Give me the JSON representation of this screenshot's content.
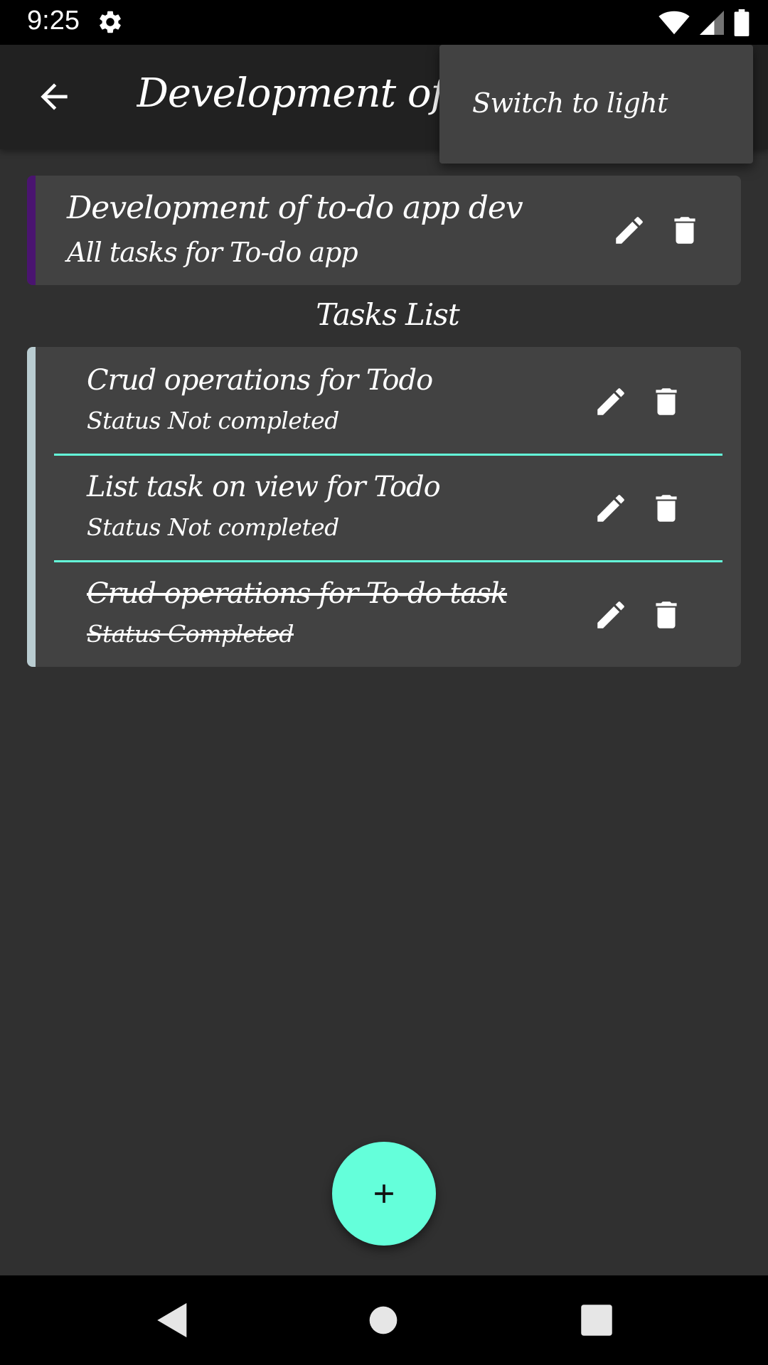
{
  "status_bar": {
    "time": "9:25",
    "icons": [
      "gear-icon",
      "wifi-icon",
      "signal-icon",
      "battery-icon"
    ]
  },
  "app_bar": {
    "title": "Development of to-do app dev",
    "back_icon": "arrow-back-icon"
  },
  "overflow_menu": {
    "items": [
      {
        "label": "Switch to light"
      }
    ]
  },
  "project": {
    "title": "Development of to-do app dev",
    "description": "All tasks for To-do app",
    "accent_color": "#4a1470",
    "icons": [
      "edit-icon",
      "delete-icon"
    ]
  },
  "tasks_section": {
    "heading": "Tasks List",
    "accent_color": "#b9ccd1",
    "divider_color": "#64ffda",
    "tasks": [
      {
        "title": "Crud operations for Todo",
        "status": "Status Not completed",
        "completed": false
      },
      {
        "title": "List task on view for Todo",
        "status": "Status Not completed",
        "completed": false
      },
      {
        "title": "Crud operations for To-do task",
        "status": "Status Completed",
        "completed": true
      }
    ]
  },
  "fab": {
    "icon": "plus-icon",
    "color": "#64ffda"
  },
  "nav_bar": {
    "icons": [
      "nav-back-icon",
      "nav-home-icon",
      "nav-recents-icon"
    ]
  },
  "theme": {
    "background": "#303030",
    "card": "#424242",
    "app_bar": "#212121"
  }
}
